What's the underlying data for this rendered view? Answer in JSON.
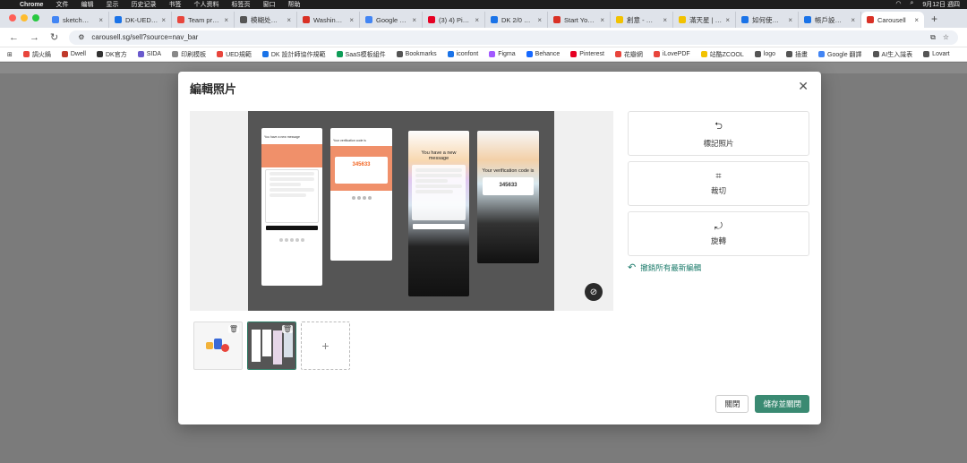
{
  "menubar": {
    "app": "Chrome",
    "items": [
      "文件",
      "编辑",
      "显示",
      "历史记录",
      "书签",
      "个人资料",
      "标签页",
      "窗口",
      "帮助"
    ],
    "clock": "9月12日 週四"
  },
  "tabs": [
    {
      "label": "sketch如何...",
      "color": "#4285f4"
    },
    {
      "label": "DK-UED设计...",
      "color": "#1a73e8"
    },
    {
      "label": "Team project",
      "color": "#e8453c"
    },
    {
      "label": "模糊处理实...",
      "color": "#555555"
    },
    {
      "label": "Washington",
      "color": "#d93025"
    },
    {
      "label": "Google 翻譯",
      "color": "#4285f4"
    },
    {
      "label": "(3) 4) Pinter...",
      "color": "#e60023"
    },
    {
      "label": "DK 2/0 接口...",
      "color": "#1a73e8"
    },
    {
      "label": "Start Your UI",
      "color": "#d93025"
    },
    {
      "label": "創意 - 虎小宮",
      "color": "#f2c200"
    },
    {
      "label": "滿天星 | 網... ",
      "color": "#f2c200"
    },
    {
      "label": "如何使用設...",
      "color": "#1a73e8"
    },
    {
      "label": "帳戶設定 - 旋...",
      "color": "#1a73e8"
    },
    {
      "label": "Carousell",
      "color": "#d93025",
      "active": true
    }
  ],
  "address": {
    "url": "carousell.sg/sell?source=nav_bar"
  },
  "bookmarks": [
    {
      "label": "調火鍋",
      "color": "#e8453c"
    },
    {
      "label": "Dwell",
      "color": "#c0392b"
    },
    {
      "label": "DK官方",
      "color": "#333333"
    },
    {
      "label": "SIDA",
      "color": "#6a5acd"
    },
    {
      "label": "印刷模板",
      "color": "#888888"
    },
    {
      "label": "UED規範",
      "color": "#e8453c"
    },
    {
      "label": "DK 設計師協作規範",
      "color": "#1a73e8"
    },
    {
      "label": "SaaS模板組件",
      "color": "#0f9d58"
    },
    {
      "label": "Bookmarks",
      "color": "#555555"
    },
    {
      "label": "iconfont",
      "color": "#1a73e8"
    },
    {
      "label": "Figma",
      "color": "#a259ff"
    },
    {
      "label": "Behance",
      "color": "#1769ff"
    },
    {
      "label": "Pinterest",
      "color": "#e60023"
    },
    {
      "label": "花瓣網",
      "color": "#e8453c"
    },
    {
      "label": "iLovePDF",
      "color": "#e8453c"
    },
    {
      "label": "站酷ZCOOL",
      "color": "#f2c200"
    },
    {
      "label": "logo",
      "color": "#555555"
    },
    {
      "label": "插畫",
      "color": "#555555"
    },
    {
      "label": "Google 翻譯",
      "color": "#4285f4"
    },
    {
      "label": "AI生入識表",
      "color": "#555555"
    },
    {
      "label": "Lovart",
      "color": "#555555"
    }
  ],
  "modal": {
    "title": "編輯照片",
    "actions": {
      "edit_label": "標記照片",
      "crop_label": "裁切",
      "rotate_label": "旋轉"
    },
    "reset_label": "撤銷所有最新編輯",
    "close_label": "關閉",
    "save_label": "儲存並關閉"
  },
  "phones": {
    "p1_title": "You have a new message",
    "p2_title": "Your verification code is",
    "p2_code": "345633",
    "p3_title": "You have a new message",
    "p4_title": "Your verification code is",
    "p4_code": "345633"
  },
  "icons": {
    "close": "close-icon",
    "mark": "mark-photo-icon",
    "crop": "crop-icon",
    "rotate": "rotate-icon",
    "reset": "undo-icon",
    "hide": "eye-off-icon",
    "delete": "trash-icon",
    "add": "plus-icon"
  },
  "colors": {
    "accent": "#3a8a72",
    "reset_text": "#1a7a6a"
  }
}
